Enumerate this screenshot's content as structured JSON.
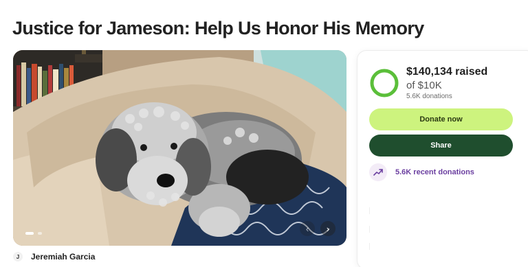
{
  "page": {
    "title": "Justice for Jameson: Help Us Honor His Memory"
  },
  "hero": {
    "image_alt": "Grey curly-haired dog lying on a beige couch",
    "slide_count": 2,
    "active_slide": 1,
    "prev_arrow": "‹",
    "next_arrow": "›"
  },
  "organizer": {
    "initial": "J",
    "name": "Jeremiah Garcia"
  },
  "donation_card": {
    "raised": "$140,134 raised",
    "goal": "of $10K",
    "donation_count": "5.6K donations",
    "progress_fraction": 1.0,
    "donate_label": "Donate now",
    "share_label": "Share",
    "recent_label": "5.6K recent donations"
  },
  "colors": {
    "progress_green": "#5bbf3a",
    "donate_bg": "#cdf37e",
    "share_bg": "#1f4e2e",
    "recent_text": "#6b3fa0"
  },
  "icons": {
    "trend": "trending-up-icon"
  }
}
